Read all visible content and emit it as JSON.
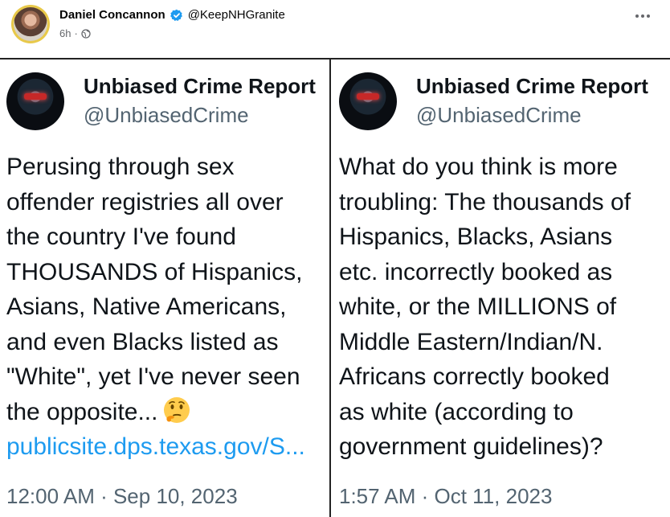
{
  "post": {
    "author_name": "Daniel Concannon",
    "author_handle": "@KeepNHGranite",
    "time": "6h",
    "separator": "·"
  },
  "icons": {
    "verified": "verified-badge-icon",
    "privacy": "globe-icon",
    "more": "more-options-icon",
    "emoji": "thinking-face-icon"
  },
  "colors": {
    "verified_blue": "#1d9bf0",
    "link_blue": "#1d9bf0",
    "avatar_ring": "#e8c94a"
  },
  "tweets": [
    {
      "name": "Unbiased Crime Report",
      "handle": "@UnbiasedCrime",
      "lines": [
        "Perusing through sex",
        "offender registries all over",
        "the country I've found",
        "THOUSANDS of Hispanics,",
        "Asians, Native Americans,",
        "and even Blacks listed as",
        "\"White\", yet I've never seen",
        "the opposite..."
      ],
      "link": "publicsite.dps.texas.gov/S...",
      "timestamp": "12:00 AM · Sep 10, 2023"
    },
    {
      "name": "Unbiased Crime Report",
      "handle": "@UnbiasedCrime",
      "lines": [
        "What do you think is more",
        "troubling: The thousands of",
        "Hispanics, Blacks, Asians",
        "etc. incorrectly booked as",
        "white, or the MILLIONS of",
        "Middle Eastern/Indian/N.",
        "Africans correctly booked",
        "as white (according to",
        "government guidelines)?"
      ],
      "timestamp": "1:57 AM · Oct 11, 2023"
    }
  ]
}
